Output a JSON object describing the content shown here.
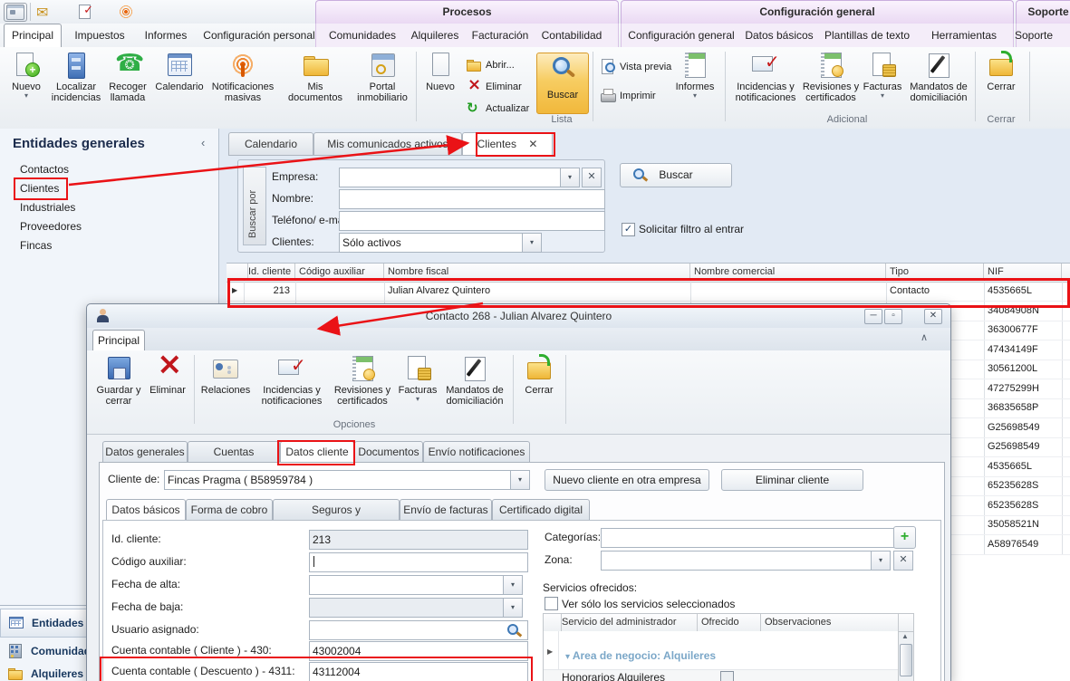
{
  "colors": {
    "annotation": "#ea1216",
    "search_highlight": "#f7cd62",
    "group_row_text": "#7ba7c8"
  },
  "context_groups": [
    "Procesos",
    "Configuración general",
    "Soporte"
  ],
  "tabs_main": [
    "Principal",
    "Impuestos",
    "Informes",
    "Configuración personal",
    "Comunidades",
    "Alquileres",
    "Facturación",
    "Contabilidad",
    "Configuración general",
    "Datos básicos",
    "Plantillas de texto",
    "Herramientas",
    "Soporte"
  ],
  "rb": {
    "nuevo": "Nuevo",
    "localizar": "Localizar incidencias",
    "recoger": "Recoger llamada",
    "calendario": "Calendario",
    "notif": "Notificaciones masivas",
    "misdoc": "Mis documentos",
    "portal": "Portal inmobiliario",
    "nuevo2": "Nuevo",
    "abrir": "Abrir...",
    "eliminar": "Eliminar",
    "actualizar": "Actualizar",
    "buscar": "Buscar",
    "lista": "Lista",
    "vista": "Vista previa",
    "imprimir": "Imprimir",
    "informes": "Informes",
    "incid": "Incidencias y notificaciones",
    "revis": "Revisiones y certificados",
    "facturas": "Facturas",
    "mandatos": "Mandatos de domiciliación",
    "adicional": "Adicional",
    "cerrar": "Cerrar",
    "cerrar_lbl": "Cerrar"
  },
  "sidebar": {
    "title": "Entidades generales",
    "items": [
      "Contactos",
      "Clientes",
      "Industriales",
      "Proveedores",
      "Fincas"
    ]
  },
  "nav_bottom": [
    "Entidades",
    "Comunidades",
    "Alquileres"
  ],
  "doc_tabs": [
    "Calendario",
    "Mis comunicados activos",
    "Clientes"
  ],
  "search": {
    "vertical": "Buscar por",
    "empresa": "Empresa:",
    "nombre": "Nombre:",
    "telefono": "Teléfono/ e-mail:",
    "clientes": "Clientes:",
    "clientes_value": "Sólo activos",
    "buscar": "Buscar",
    "filtro": "Solicitar filtro al entrar"
  },
  "grid": {
    "cols": [
      "Id. cliente",
      "Código auxiliar",
      "Nombre fiscal",
      "Nombre comercial",
      "Tipo",
      "NIF"
    ],
    "row": {
      "id": "213",
      "codigo": "",
      "fiscal": "Julian Alvarez Quintero",
      "comercial": "",
      "tipo": "Contacto",
      "nif": "4535665L"
    },
    "nifs": [
      "34084908N",
      "36300677F",
      "47434149F",
      "30561200L",
      "47275299H",
      "36835658P",
      "G25698549",
      "G25698549",
      "4535665L",
      "65235628S",
      "65235628S",
      "35058521N",
      "A58976549"
    ]
  },
  "dlg": {
    "title": "Contacto 268 - Julian Alvarez Quintero",
    "tab": "Principal",
    "guardar": "Guardar y cerrar",
    "eliminar": "Eliminar",
    "relaciones": "Relaciones",
    "incid": "Incidencias y notificaciones",
    "revis": "Revisiones y certificados",
    "facturas": "Facturas",
    "mandatos": "Mandatos de domiciliación",
    "opciones": "Opciones",
    "cerrar": "Cerrar",
    "tabs": [
      "Datos generales",
      "Cuentas bancarias",
      "Datos cliente",
      "Documentos",
      "Envío notificaciones"
    ],
    "cliente_de": "Cliente de:",
    "cliente_de_value": "Fincas Pragma ( B58959784 )",
    "btn_nuevo": "Nuevo cliente en otra empresa",
    "btn_eliminar": "Eliminar cliente",
    "subtabs": [
      "Datos básicos",
      "Forma de cobro",
      "Seguros y mantenimientos",
      "Envío de facturas",
      "Certificado digital"
    ],
    "f": [
      {
        "l": "Id. cliente:",
        "v": "213"
      },
      {
        "l": "Código auxiliar:",
        "v": ""
      },
      {
        "l": "Fecha de alta:",
        "v": ""
      },
      {
        "l": "Fecha de baja:",
        "v": ""
      },
      {
        "l": "Usuario asignado:",
        "v": ""
      },
      {
        "l": "Cuenta contable ( Cliente ) - 430:",
        "v": "43002004"
      },
      {
        "l": "Cuenta contable ( Descuento ) - 4311:",
        "v": "43112004"
      }
    ],
    "categorias": "Categorías:",
    "zona": "Zona:",
    "servicios": "Servicios ofrecidos:",
    "ver_solo": "Ver sólo los servicios seleccionados",
    "svc_cols": [
      "Servicio del administrador",
      "Ofrecido",
      "Observaciones"
    ],
    "svc_group": "Area de negocio: Alquileres",
    "svc_row": "Honorarios Alquileres"
  }
}
